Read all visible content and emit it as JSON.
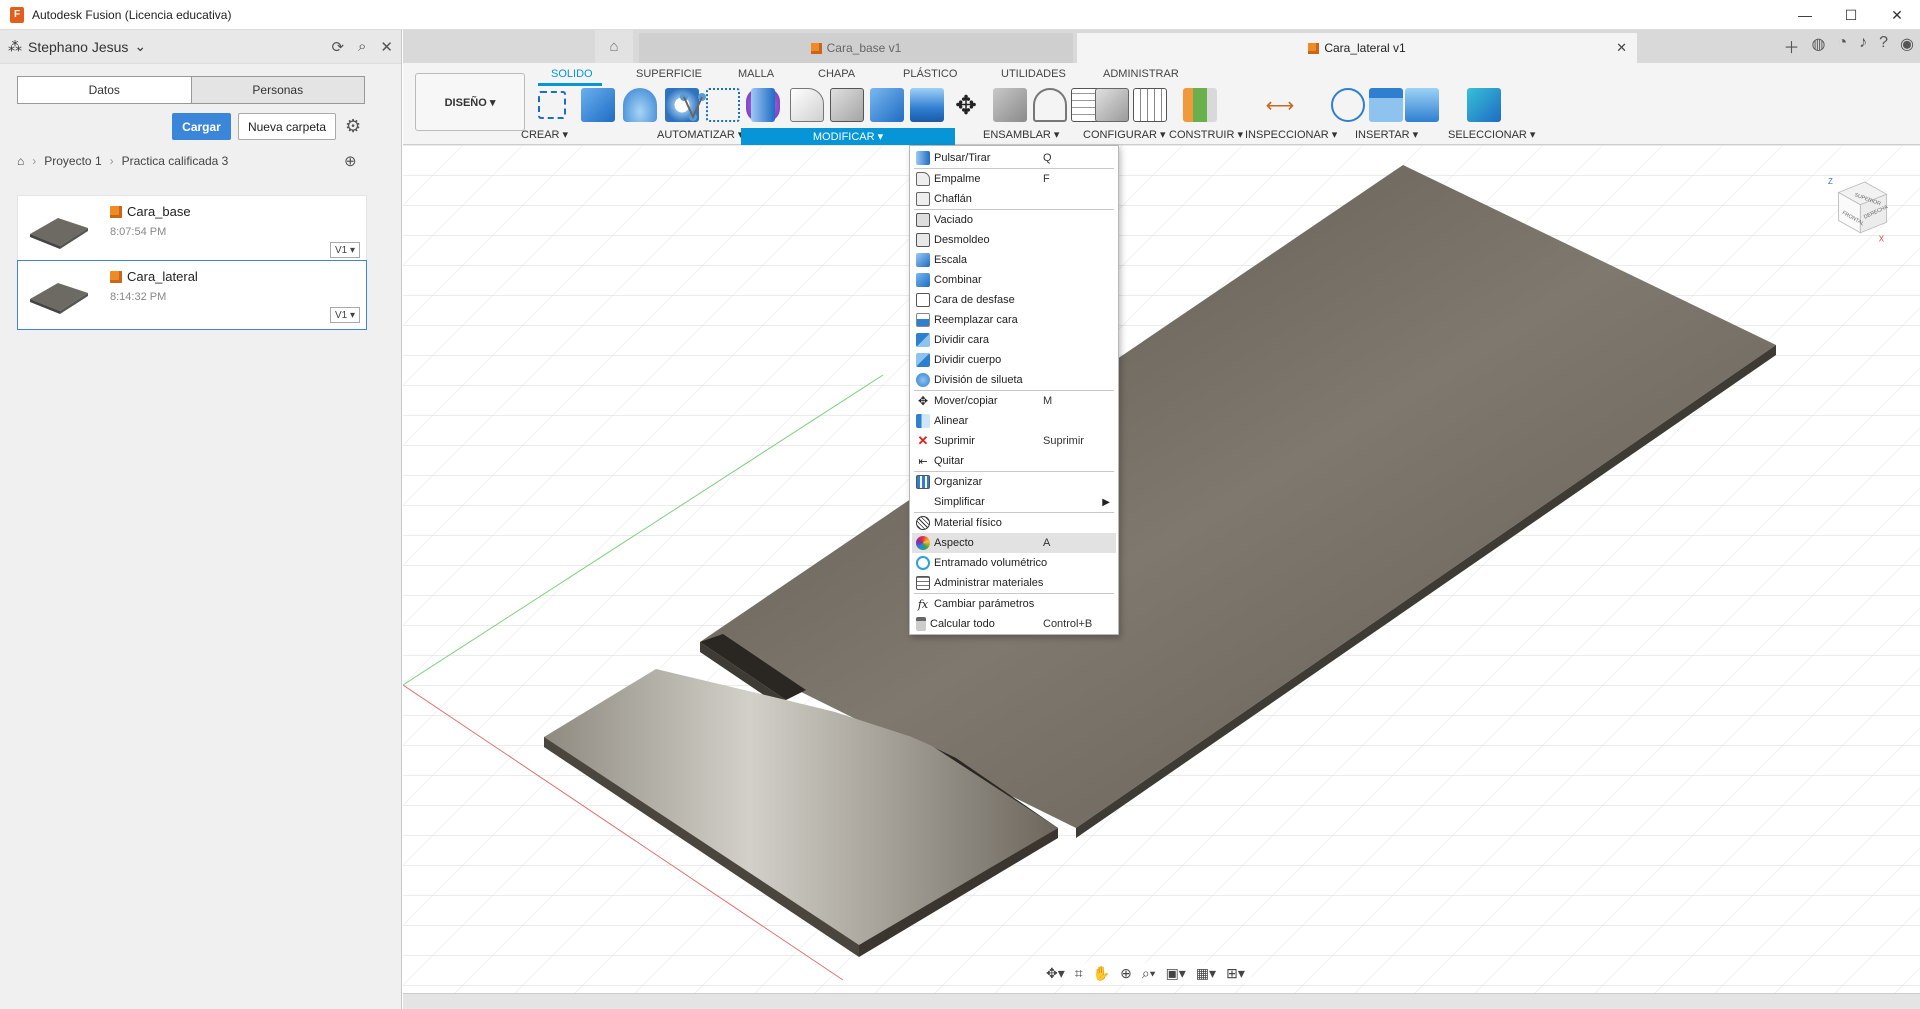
{
  "window": {
    "title": "Autodesk Fusion (Licencia educativa)",
    "minimize": "—",
    "maximize": "☐",
    "close": "✕"
  },
  "user": {
    "name": "Stephano Jesus"
  },
  "data_panel": {
    "tabs": [
      "Datos",
      "Personas"
    ],
    "upload_label": "Cargar",
    "new_folder_label": "Nueva carpeta",
    "breadcrumb": [
      "Proyecto 1",
      "Practica calificada 3"
    ],
    "files": [
      {
        "name": "Cara_base",
        "time": "8:07:54 PM",
        "version": "V1 ▾"
      },
      {
        "name": "Cara_lateral",
        "time": "8:14:32 PM",
        "version": "V1 ▾"
      }
    ]
  },
  "doc_tabs": [
    {
      "label": "Cara_base v1",
      "active": false
    },
    {
      "label": "Cara_lateral v1",
      "active": true
    }
  ],
  "toolbar": {
    "workspace": "DISEÑO ▾",
    "ribbon_tabs": [
      "SOLIDO",
      "SUPERFICIE",
      "MALLA",
      "CHAPA",
      "PLÁSTICO",
      "UTILIDADES",
      "ADMINISTRAR"
    ],
    "groups": [
      "CREAR ▾",
      "AUTOMATIZAR ▾",
      "MODIFICAR ▾",
      "ENSAMBLAR ▾",
      "CONFIGURAR ▾",
      "CONSTRUIR ▾",
      "INSPECCIONAR ▾",
      "INSERTAR ▾",
      "SELECCIONAR ▾"
    ]
  },
  "modify_menu": {
    "items": [
      {
        "label": "Pulsar/Tirar",
        "shortcut": "Q"
      },
      {
        "label": "Empalme",
        "shortcut": "F"
      },
      {
        "label": "Chaflán",
        "shortcut": ""
      },
      {
        "label": "Vaciado",
        "shortcut": ""
      },
      {
        "label": "Desmoldeo",
        "shortcut": ""
      },
      {
        "label": "Escala",
        "shortcut": ""
      },
      {
        "label": "Combinar",
        "shortcut": ""
      },
      {
        "label": "Cara de desfase",
        "shortcut": ""
      },
      {
        "label": "Reemplazar cara",
        "shortcut": ""
      },
      {
        "label": "Dividir cara",
        "shortcut": ""
      },
      {
        "label": "Dividir cuerpo",
        "shortcut": ""
      },
      {
        "label": "División de silueta",
        "shortcut": ""
      },
      {
        "label": "Mover/copiar",
        "shortcut": "M"
      },
      {
        "label": "Alinear",
        "shortcut": ""
      },
      {
        "label": "Suprimir",
        "shortcut": "Suprimir"
      },
      {
        "label": "Quitar",
        "shortcut": ""
      },
      {
        "label": "Organizar",
        "shortcut": ""
      },
      {
        "label": "Simplificar",
        "shortcut": ""
      },
      {
        "label": "Material físico",
        "shortcut": ""
      },
      {
        "label": "Aspecto",
        "shortcut": "A"
      },
      {
        "label": "Entramado volumétrico",
        "shortcut": ""
      },
      {
        "label": "Administrar materiales",
        "shortcut": ""
      },
      {
        "label": "Cambiar parámetros",
        "shortcut": ""
      },
      {
        "label": "Calcular todo",
        "shortcut": "Control+B"
      }
    ]
  },
  "viewcube": {
    "top": "SUPERIOR",
    "front": "FRONTAL",
    "right": "DERECHA",
    "z": "Z",
    "x": "X"
  },
  "colors": {
    "accent": "#0696d7",
    "primary_button": "#3b86d9",
    "doc_icon": "#f08a24"
  }
}
